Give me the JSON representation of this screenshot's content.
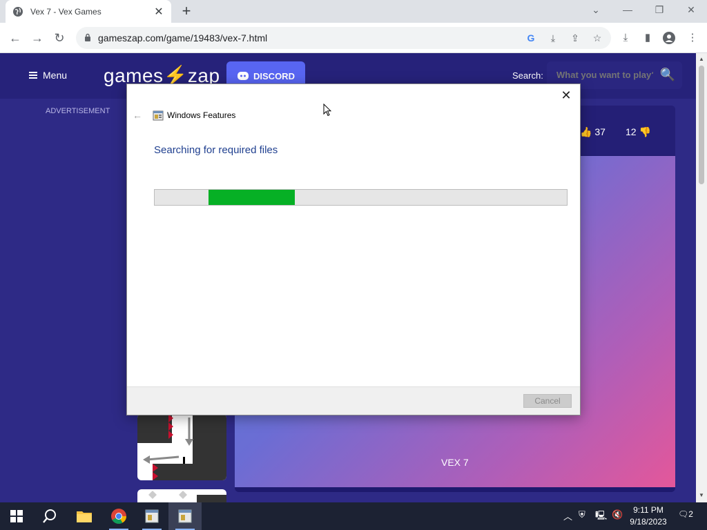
{
  "browser": {
    "tab_title": "Vex 7 - Vex Games",
    "url": "gameszap.com/game/19483/vex-7.html",
    "new_tab_label": "+"
  },
  "site": {
    "menu_label": "Menu",
    "logo_left": "games",
    "logo_bolt": "⚡",
    "logo_right": "zap",
    "discord_label": "DISCORD",
    "search_label": "Search:",
    "search_placeholder": "What you want to play?",
    "advertisement": "ADVERTISEMENT",
    "likes": "37",
    "dislikes": "12",
    "game_name": "VEX 7"
  },
  "dialog": {
    "title": "Windows Features",
    "heading": "Searching for required files",
    "progress_start": 0.13,
    "progress_end": 0.34,
    "progress_color": "#06b025",
    "cancel_label": "Cancel"
  },
  "taskbar": {
    "time": "9:11 PM",
    "date": "9/18/2023",
    "notification_count": "2"
  },
  "colors": {
    "site_bg": "#2e2a86",
    "discord": "#5865f2",
    "logo_bolt": "#f6c21c"
  }
}
